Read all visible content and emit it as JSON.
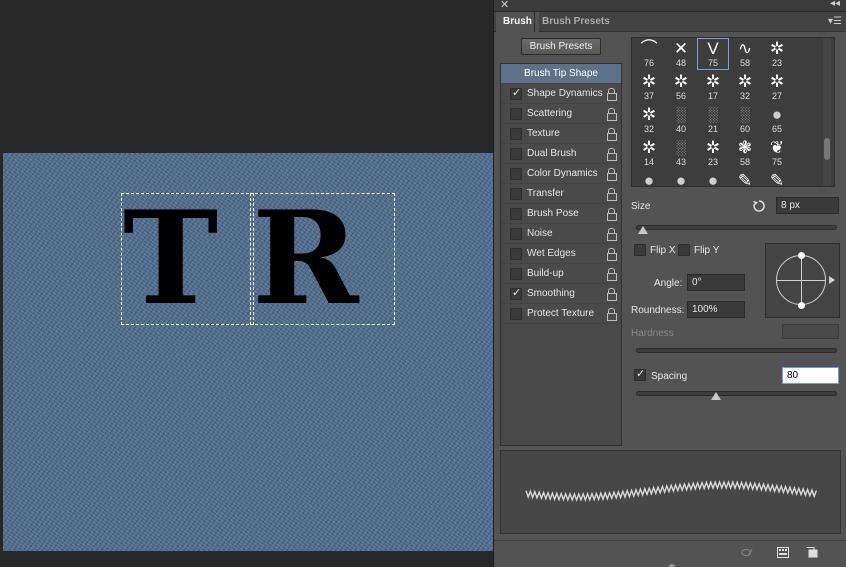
{
  "panel": {
    "tabs": [
      "Brush",
      "Brush Presets"
    ],
    "presets_button": "Brush Presets"
  },
  "canvas": {
    "text": [
      "T",
      "R"
    ]
  },
  "options": [
    {
      "label": "Brush Tip Shape",
      "header": true
    },
    {
      "label": "Shape Dynamics",
      "checked": true
    },
    {
      "label": "Scattering",
      "checked": false
    },
    {
      "label": "Texture",
      "checked": false
    },
    {
      "label": "Dual Brush",
      "checked": false
    },
    {
      "label": "Color Dynamics",
      "checked": false
    },
    {
      "label": "Transfer",
      "checked": false
    },
    {
      "label": "Brush Pose",
      "checked": false
    },
    {
      "label": "Noise",
      "checked": false
    },
    {
      "label": "Wet Edges",
      "checked": false
    },
    {
      "label": "Build-up",
      "checked": false
    },
    {
      "label": "Smoothing",
      "checked": true
    },
    {
      "label": "Protect Texture",
      "checked": false
    }
  ],
  "brush_tips": [
    {
      "num": "76",
      "icon": "wave-hump-icon"
    },
    {
      "num": "48",
      "icon": "x-stroke-icon"
    },
    {
      "num": "75",
      "icon": "v-stroke-icon",
      "selected": true
    },
    {
      "num": "58",
      "icon": "wave-stroke-icon"
    },
    {
      "num": "23",
      "icon": "splatter-icon"
    },
    {
      "num": "37",
      "icon": "splatter-icon"
    },
    {
      "num": "56",
      "icon": "splatter-icon"
    },
    {
      "num": "17",
      "icon": "splatter-icon"
    },
    {
      "num": "32",
      "icon": "splatter-icon"
    },
    {
      "num": "27",
      "icon": "splatter-icon"
    },
    {
      "num": "32",
      "icon": "splatter-icon"
    },
    {
      "num": "40",
      "icon": "noise-icon"
    },
    {
      "num": "21",
      "icon": "noise-icon"
    },
    {
      "num": "60",
      "icon": "noise-icon"
    },
    {
      "num": "65",
      "icon": "soft-round-icon"
    },
    {
      "num": "14",
      "icon": "splatter-icon"
    },
    {
      "num": "43",
      "icon": "noise-icon"
    },
    {
      "num": "23",
      "icon": "splatter-icon"
    },
    {
      "num": "58",
      "icon": "texture-icon"
    },
    {
      "num": "75",
      "icon": "leaf-icon"
    },
    {
      "num": "",
      "icon": "soft-round-icon"
    },
    {
      "num": "",
      "icon": "soft-round-icon"
    },
    {
      "num": "",
      "icon": "soft-round-icon"
    },
    {
      "num": "",
      "icon": "pencil-tip-icon"
    },
    {
      "num": "",
      "icon": "pencil-tip-icon"
    }
  ],
  "size": {
    "label": "Size",
    "value": "8 px",
    "fraction": 0.02
  },
  "flip_x": {
    "label": "Flip X",
    "checked": false
  },
  "flip_y": {
    "label": "Flip Y",
    "checked": false
  },
  "angle": {
    "label": "Angle:",
    "value": "0°"
  },
  "roundness": {
    "label": "Roundness:",
    "value": "100%"
  },
  "hardness": {
    "label": "Hardness",
    "value": ""
  },
  "spacing": {
    "label": "Spacing",
    "checked": true,
    "value": "80",
    "fraction": 0.4
  },
  "colors": {
    "selected_option": "#5d718b",
    "canvas": "#4f6d8d",
    "panel": "#535353"
  }
}
